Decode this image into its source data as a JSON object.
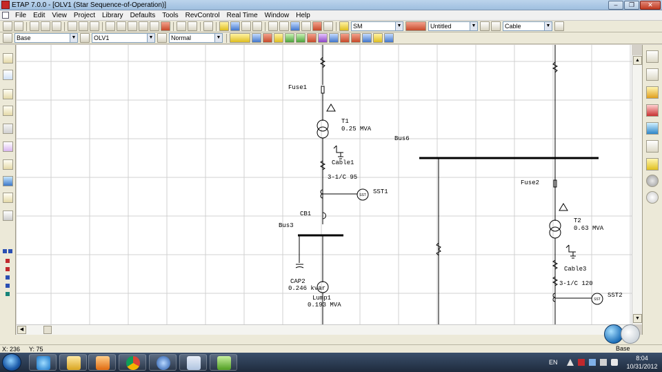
{
  "window": {
    "title": "ETAP 7.0.0 - [OLV1 (Star Sequence-of-Operation)]"
  },
  "menu": [
    "File",
    "Edit",
    "View",
    "Project",
    "Library",
    "Defaults",
    "Tools",
    "RevControl",
    "Real Time",
    "Window",
    "Help"
  ],
  "toolbar1": {
    "config_combo": "SM",
    "revision_combo": "Untitled",
    "element_combo": "Cable"
  },
  "toolbar2": {
    "presentation_combo": "Base",
    "diagram_combo": "OLV1",
    "mode_combo": "Normal"
  },
  "diagram": {
    "labels": {
      "fuse1": "Fuse1",
      "t1_name": "T1",
      "t1_rating": "0.25 MVA",
      "cable1_name": "Cable1",
      "cable1_spec": "3-1/C 95",
      "sst1": "SST1",
      "cb1": "CB1",
      "bus3": "Bus3",
      "cap2_name": "CAP2",
      "cap2_rating": "0.246 kvar",
      "lump1_name": "Lump1",
      "lump1_rating": "0.193 MVA",
      "bus6": "Bus6",
      "fuse2": "Fuse2",
      "t2_name": "T2",
      "t2_rating": "0.63 MVA",
      "cable3_name": "Cable3",
      "cable3_spec": "3-1/C 120",
      "sst2": "SST2",
      "sst_badge": "SST"
    }
  },
  "statusbar": {
    "x": "X: 236",
    "y": "Y: 75",
    "presentation": "Base"
  },
  "taskbar": {
    "language": "EN",
    "clock_time": "8:04",
    "clock_date": "10/31/2012"
  },
  "colors": {
    "title_bar": "#9fbfdf",
    "canvas_bg": "#ffffff",
    "grid": "#d0d0d0",
    "taskbar": "#1f2b3d"
  }
}
